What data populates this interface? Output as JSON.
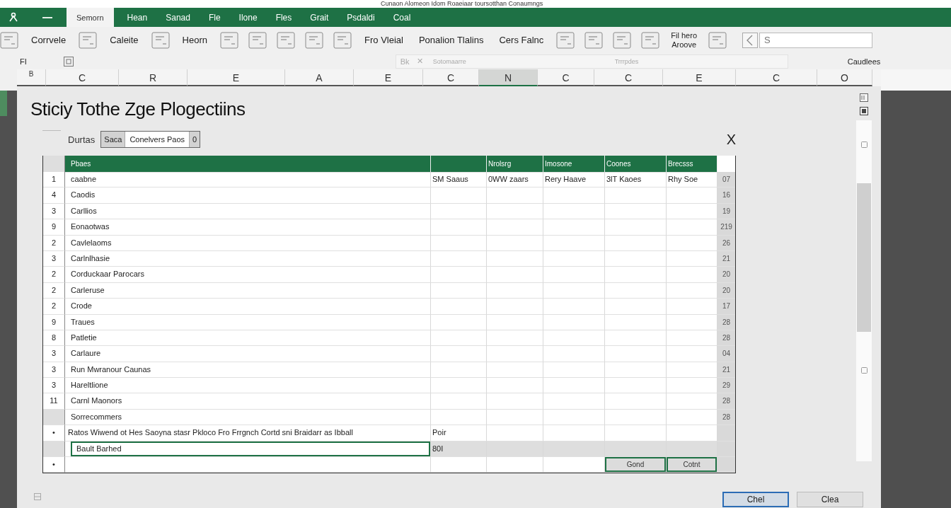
{
  "window": {
    "title": "Cunaon Alomeon Idom Roaeiaar toursotthan Conaumngs"
  },
  "ribbon_tabs": [
    {
      "label": "Semorn",
      "selected": true
    },
    {
      "label": "Hean",
      "selected": false
    },
    {
      "label": "Sanad",
      "selected": false
    },
    {
      "label": "Fle",
      "selected": false
    },
    {
      "label": "Ilone",
      "selected": false
    },
    {
      "label": "Fles",
      "selected": false
    },
    {
      "label": "Grait",
      "selected": false
    },
    {
      "label": "Psdaldi",
      "selected": false
    },
    {
      "label": "Coal",
      "selected": false
    }
  ],
  "toolbar": [
    {
      "kind": "icon"
    },
    {
      "kind": "label",
      "label": "Corrvele"
    },
    {
      "kind": "icon"
    },
    {
      "kind": "label",
      "label": "Caleite"
    },
    {
      "kind": "icon"
    },
    {
      "kind": "label",
      "label": "Heorn"
    },
    {
      "kind": "icon"
    },
    {
      "kind": "icon"
    },
    {
      "kind": "icon"
    },
    {
      "kind": "icon"
    },
    {
      "kind": "icon"
    },
    {
      "kind": "label",
      "label": "Fro Vleial"
    },
    {
      "kind": "label",
      "label": "Ponalion Tlalins"
    },
    {
      "kind": "label",
      "label": "Cers Falnc"
    },
    {
      "kind": "icon"
    },
    {
      "kind": "icon"
    },
    {
      "kind": "icon"
    },
    {
      "kind": "icon"
    },
    {
      "kind": "stacked",
      "lines": [
        "Fil hero",
        "Aroove"
      ]
    },
    {
      "kind": "icon"
    }
  ],
  "search": {
    "placeholder": "S"
  },
  "formula_bar": {
    "cell": "FI",
    "buttons": [
      "Bk",
      "✕"
    ],
    "value": "Sotomaarre",
    "hint": "Trrrpdes"
  },
  "pane_label": "Caudlees",
  "columns": [
    {
      "label": "B",
      "selected": false
    },
    {
      "label": "C",
      "selected": false
    },
    {
      "label": "R",
      "selected": false
    },
    {
      "label": "E",
      "selected": false
    },
    {
      "label": "A",
      "selected": false
    },
    {
      "label": "E",
      "selected": false
    },
    {
      "label": "C",
      "selected": false
    },
    {
      "label": "N",
      "selected": true
    },
    {
      "label": "C",
      "selected": false
    },
    {
      "label": "C",
      "selected": false
    },
    {
      "label": "E",
      "selected": false
    },
    {
      "label": "C",
      "selected": false
    },
    {
      "label": "O",
      "selected": false
    }
  ],
  "dialog": {
    "title": "Sticiy Tothe Zge Plogectiins",
    "close": "X",
    "filter": {
      "label": "Durtas",
      "segments": [
        {
          "label": "Saca",
          "selected": false
        },
        {
          "label": "Conelvers Paos",
          "selected": true
        },
        {
          "label": "0",
          "selected": false
        }
      ]
    },
    "table": {
      "header": {
        "column_1": "Pbaes",
        "column_3": "Nrolsrg",
        "column_4": "Imosone",
        "column_5": "Coones",
        "column_6": "Brecsss"
      },
      "rows": [
        {
          "kind": "data",
          "num": "1",
          "name": "caabne",
          "cells": [
            "SM Saaus",
            "0WW zaars",
            "Rery Haave",
            "3lT Kaoes",
            "Rhy Soe"
          ],
          "side": "07"
        },
        {
          "kind": "data",
          "num": "4",
          "name": "Caodis",
          "side": "16"
        },
        {
          "kind": "data",
          "num": "3",
          "name": "Carllios",
          "side": "19"
        },
        {
          "kind": "data",
          "num": "9",
          "name": "Eonaotwas",
          "side": "219"
        },
        {
          "kind": "data",
          "num": "2",
          "name": "Cavlelaoms",
          "side": "26"
        },
        {
          "kind": "data",
          "num": "3",
          "name": "Carlnlhasie",
          "side": "21"
        },
        {
          "kind": "data",
          "num": "2",
          "name": "Corduckaar Parocars",
          "side": "20"
        },
        {
          "kind": "data",
          "num": "2",
          "name": "Carleruse",
          "side": "20"
        },
        {
          "kind": "data",
          "num": "2",
          "name": "Crode",
          "side": "17"
        },
        {
          "kind": "data",
          "num": "9",
          "name": "Traues",
          "side": "28"
        },
        {
          "kind": "data",
          "num": "8",
          "name": "Patletie",
          "side": "28"
        },
        {
          "kind": "data",
          "num": "3",
          "name": "Carlaure",
          "side": "04"
        },
        {
          "kind": "data",
          "num": "3",
          "name": "Run Mwranour Caunas",
          "side": "21"
        },
        {
          "kind": "data",
          "num": "3",
          "name": "Hareltlione",
          "side": "29"
        },
        {
          "kind": "data",
          "num": "11",
          "name": "Carnl Maonors",
          "side": "28"
        },
        {
          "kind": "data",
          "name": "Sorrecommers",
          "side": "28"
        },
        {
          "kind": "note",
          "num": "•",
          "name": "Ratos Wiwend ot Hes Saoyna stasr Pkloco Fro Frrgnch Cortd sni Braidarr as Ibball",
          "cells": [
            "Poir"
          ]
        },
        {
          "kind": "input",
          "value": "Bault Barhed",
          "cells": [
            "80I"
          ]
        },
        {
          "kind": "buttons",
          "num": "•",
          "buttons": [
            "Gond",
            "Cotnt"
          ]
        }
      ]
    },
    "buttons": [
      {
        "label": "Chel",
        "default": true
      },
      {
        "label": "Clea",
        "default": false
      }
    ]
  }
}
